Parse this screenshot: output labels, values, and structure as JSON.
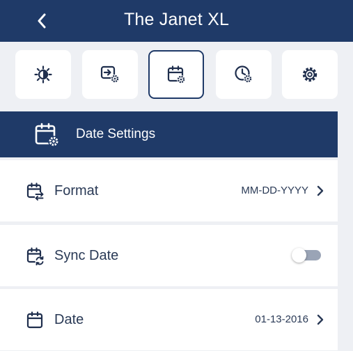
{
  "header": {
    "title": "The Janet XL",
    "back_icon": "chevron-left-icon"
  },
  "tabs": [
    {
      "icon": "brightness-icon",
      "active": false
    },
    {
      "icon": "input-settings-icon",
      "active": false
    },
    {
      "icon": "calendar-settings-icon",
      "active": true
    },
    {
      "icon": "clock-settings-icon",
      "active": false
    },
    {
      "icon": "gear-icon",
      "active": false
    }
  ],
  "section": {
    "title": "Date Settings",
    "icon": "calendar-settings-icon"
  },
  "rows": {
    "format": {
      "label": "Format",
      "value": "MM-DD-YYYY",
      "icon": "calendar-swap-icon"
    },
    "sync": {
      "label": "Sync Date",
      "icon": "calendar-sync-icon",
      "enabled": false
    },
    "date": {
      "label": "Date",
      "value": "01-13-2016",
      "icon": "calendar-icon"
    }
  },
  "colors": {
    "primary": "#1f3a68",
    "background": "#eef0f4",
    "toggle_off": "#9aa4b6"
  }
}
